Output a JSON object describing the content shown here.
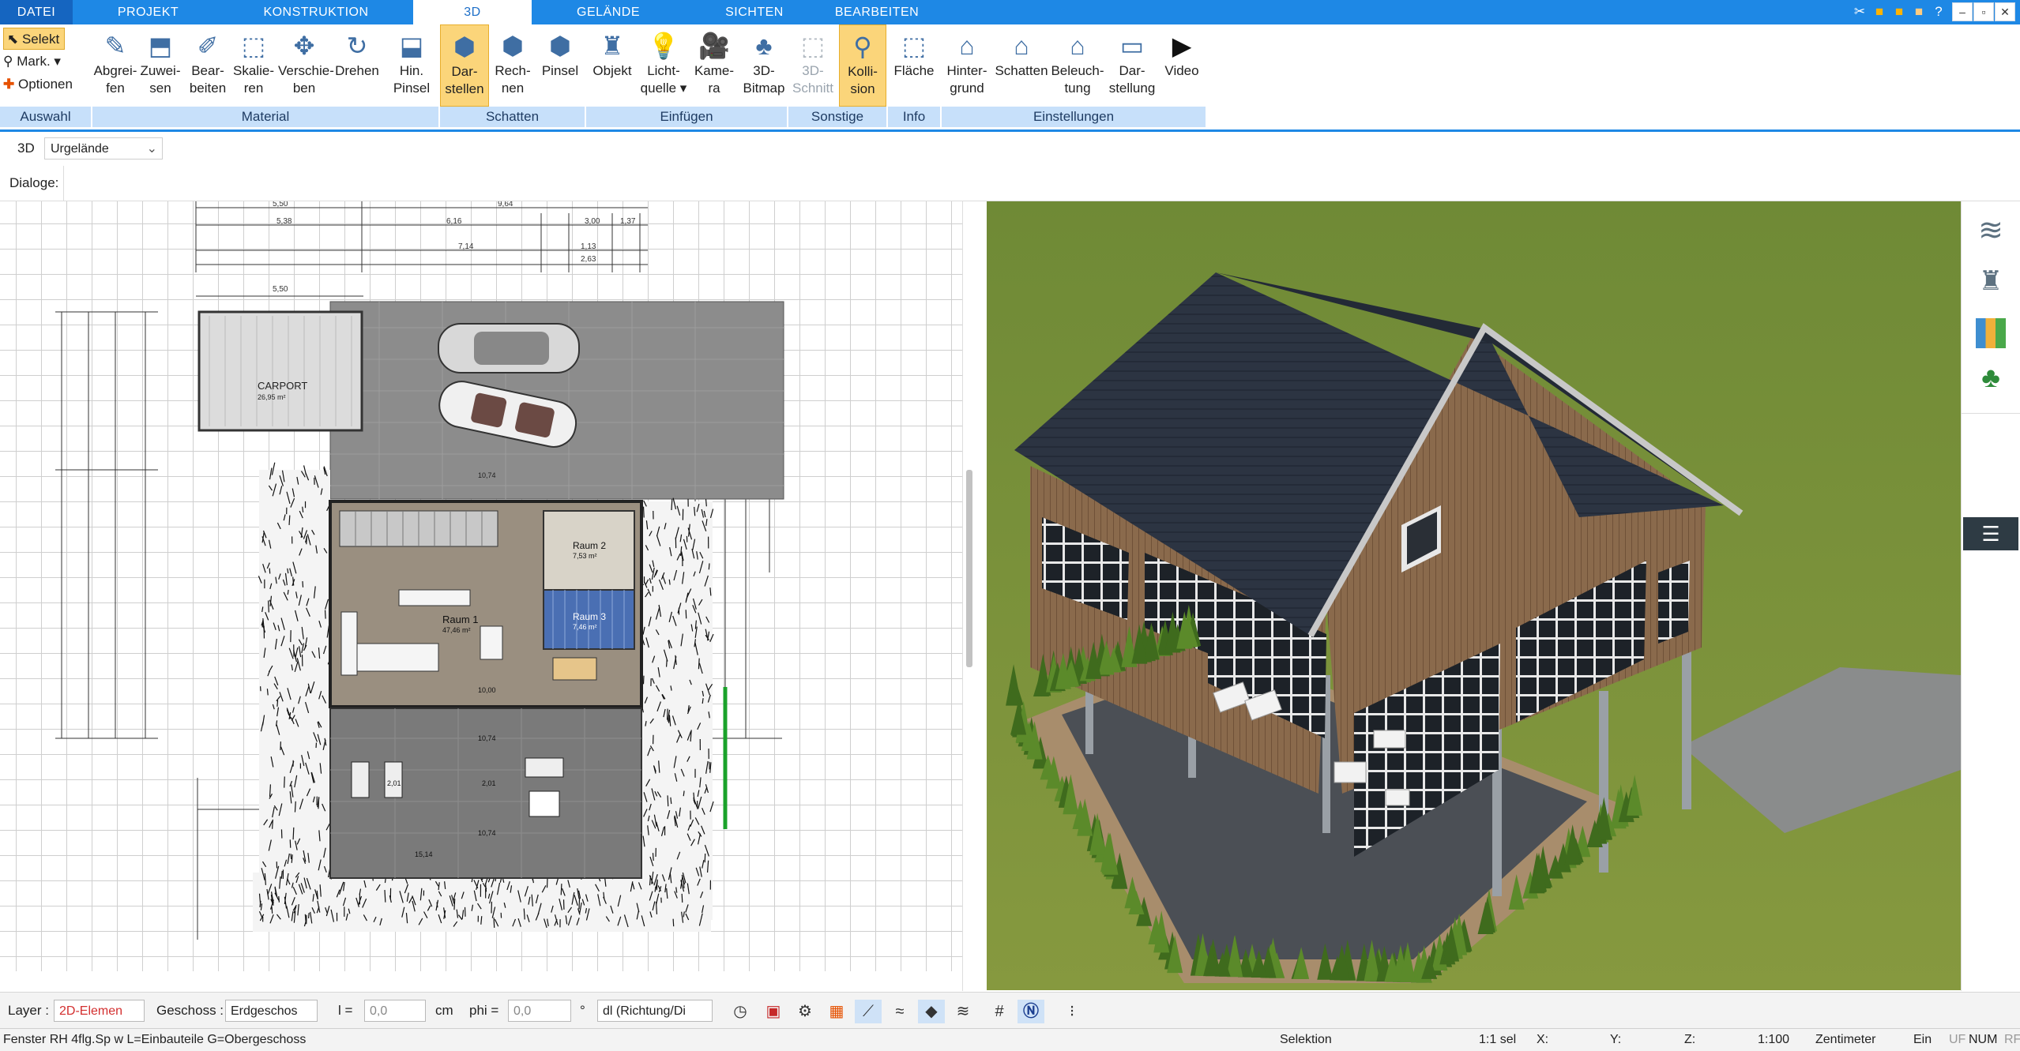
{
  "tabs": [
    {
      "label": "DATEI",
      "active": false
    },
    {
      "label": "PROJEKT",
      "active": false
    },
    {
      "label": "KONSTRUKTION",
      "active": false
    },
    {
      "label": "3D",
      "active": true
    },
    {
      "label": "GELÄNDE",
      "active": false
    },
    {
      "label": "SICHTEN",
      "active": false
    },
    {
      "label": "BEARBEITEN",
      "active": false
    }
  ],
  "window_controls": {
    "minimize": "–",
    "restore": "▫",
    "maximize": "⧉",
    "close": "✕"
  },
  "auswahl": {
    "select": "Selekt",
    "mark": "Mark.",
    "options": "Optionen",
    "group": "Auswahl"
  },
  "ribbon": {
    "buttons": [
      {
        "line1": "Abgrei-",
        "line2": "fen",
        "icon": "eyedropper-icon"
      },
      {
        "line1": "Zuwei-",
        "line2": "sen",
        "icon": "assign-icon"
      },
      {
        "line1": "Bear-",
        "line2": "beiten",
        "icon": "edit-material-icon"
      },
      {
        "line1": "Skalie-",
        "line2": "ren",
        "icon": "scale-icon"
      },
      {
        "line1": "Verschie-",
        "line2": "ben",
        "icon": "move-icon"
      },
      {
        "line1": "Drehen",
        "line2": "",
        "icon": "rotate-icon"
      },
      {
        "line1": "Hin.",
        "line2": "Pinsel",
        "icon": "background-brush-icon"
      },
      {
        "line1": "Dar-",
        "line2": "stellen",
        "icon": "shadow-display-icon"
      },
      {
        "line1": "Rech-",
        "line2": "nen",
        "icon": "calculate-icon"
      },
      {
        "line1": "Pinsel",
        "line2": "",
        "icon": "brush-icon"
      },
      {
        "line1": "Objekt",
        "line2": "",
        "icon": "chair-icon"
      },
      {
        "line1": "Licht-",
        "line2": "quelle ▾",
        "icon": "lightbulb-icon"
      },
      {
        "line1": "Kame-",
        "line2": "ra",
        "icon": "camera-icon"
      },
      {
        "line1": "3D-",
        "line2": "Bitmap",
        "icon": "tree-icon"
      },
      {
        "line1": "3D-",
        "line2": "Schnitt",
        "icon": "section-icon"
      },
      {
        "line1": "Kolli-",
        "line2": "sion",
        "icon": "collision-icon"
      },
      {
        "line1": "Fläche",
        "line2": "",
        "icon": "area-info-icon"
      },
      {
        "line1": "Hinter-",
        "line2": "grund",
        "icon": "background-icon"
      },
      {
        "line1": "Schatten",
        "line2": "",
        "icon": "shadow-house-icon"
      },
      {
        "line1": "Beleuch-",
        "line2": "tung",
        "icon": "lighting-house-icon"
      },
      {
        "line1": "Dar-",
        "line2": "stellung",
        "icon": "display-settings-icon"
      },
      {
        "line1": "Video",
        "line2": "",
        "icon": "video-play-icon"
      }
    ],
    "groups": [
      "Material",
      "Schatten",
      "Einfügen",
      "Sonstige",
      "Info",
      "Einstellungen"
    ]
  },
  "bar3d": {
    "label": "3D",
    "dropdown": "Urgelände"
  },
  "dialogs_label": "Dialoge:",
  "plan": {
    "carport_label": "CARPORT",
    "carport_area": "26,95 m²",
    "room1": "Raum 1",
    "room1_area": "47,46 m²",
    "room2": "Raum 2",
    "room2_area": "7,53 m²",
    "room3": "Raum 3",
    "room3_area": "7,46 m²",
    "dims_top": [
      "5,50",
      "9,64",
      "5,38",
      "6,16",
      "3,00",
      "1,37",
      "7,14",
      "1,13",
      "2,63"
    ],
    "dims_mid": [
      "5,50",
      "5,38",
      "10,74",
      "10,00",
      "10,74",
      "10,74",
      "2,01",
      "2,01",
      "15,14"
    ]
  },
  "bottom": {
    "layer_label": "Layer :",
    "layer_value": "2D-Elemen",
    "geschoss_label": "Geschoss :",
    "geschoss_value": "Erdgeschos",
    "l_label": "l =",
    "l_value": "0,0",
    "l_unit": "cm",
    "phi_label": "phi =",
    "phi_value": "0,0",
    "phi_unit": "°",
    "dl_value": "dl (Richtung/Di"
  },
  "status": {
    "left": "Fenster RH 4flg.Sp w L=Einbauteile G=Obergeschoss",
    "mode": "Selektion",
    "sel": "1:1 sel",
    "x": "X:",
    "y": "Y:",
    "z": "Z:",
    "scale": "1:100",
    "unit": "Zentimeter",
    "ein": "Ein",
    "uf": "UF",
    "num": "NUM",
    "rf": "RF"
  },
  "colors": {
    "accent": "#1e88e5",
    "ribbon_group": "#c7e0fa",
    "highlight": "#fbd57a",
    "grass": "#7a8f3c",
    "roof": "#2c3442",
    "wood": "#8a6a4c"
  }
}
